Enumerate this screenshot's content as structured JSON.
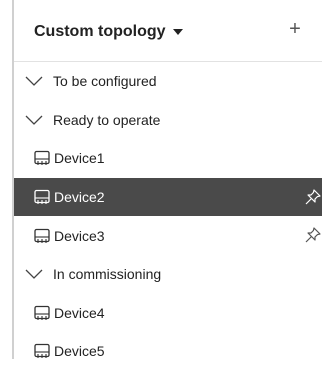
{
  "header": {
    "title": "Custom topology",
    "add_label": "+"
  },
  "tree": {
    "group_1": {
      "label": "To be configured",
      "icon": "chevron-down-icon"
    },
    "group_2": {
      "label": "Ready to operate",
      "icon": "chevron-down-icon"
    },
    "device_1": {
      "label": "Device1",
      "icon": "device-icon"
    },
    "device_2": {
      "label": "Device2",
      "icon": "device-icon",
      "selected": true,
      "pin_icon": "pin-icon"
    },
    "device_3": {
      "label": "Device3",
      "icon": "device-icon",
      "pin_icon": "pin-icon"
    },
    "group_3": {
      "label": "In commissioning",
      "icon": "chevron-down-icon"
    },
    "device_4": {
      "label": "Device4",
      "icon": "device-icon"
    },
    "device_5": {
      "label": "Device5",
      "icon": "device-icon"
    }
  },
  "colors": {
    "selected_bg": "#4a4a4a",
    "selected_fg": "#ffffff",
    "text": "#222222"
  }
}
